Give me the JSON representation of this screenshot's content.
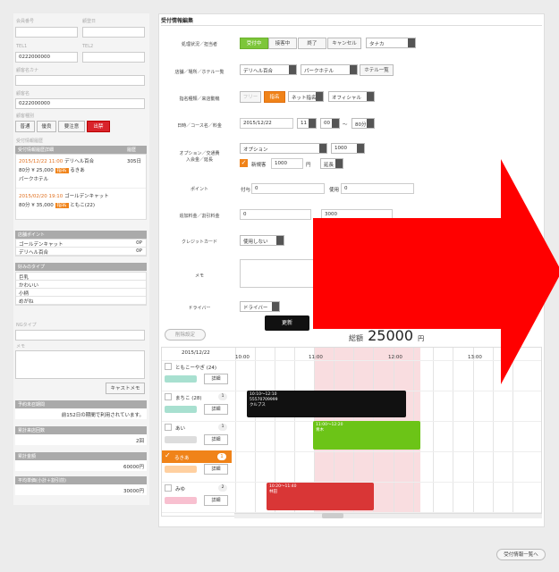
{
  "left": {
    "membership_no_label": "会員番号",
    "joined_label": "顧登日",
    "tel1_label": "TEL1",
    "tel2_label": "TEL2",
    "tel1": "0222000000",
    "name_kana_label": "顧客名カナ",
    "name_label": "顧客名",
    "name_value": "0222000000",
    "type_label": "顧客種別",
    "type_buttons": [
      "普通",
      "優良",
      "要注意",
      "出禁"
    ],
    "history_label": "受付情報履歴",
    "history_header": "受付情報履歴詳細",
    "history_header_right": "履歴",
    "history": [
      {
        "date": "2015/12/22 11:00",
        "shop": "デリヘル百合",
        "tail": "305日",
        "line2": "80分 ¥ 25,000",
        "badge": "指名",
        "girl": "るきあ",
        "line3": "パークホテル"
      },
      {
        "date": "2015/02/20 19:10",
        "shop": "ゴールデンキャット",
        "line2": "80分 ¥ 35,000",
        "badge": "指名",
        "girl": "ともこ(22)"
      }
    ],
    "points_label": "店舗ポイント",
    "points": [
      {
        "shop": "ゴールデンキャット",
        "pt": "0P"
      },
      {
        "shop": "デリヘル百合",
        "pt": "0P"
      }
    ],
    "fav_label": "好みのタイプ",
    "fav": [
      "巨乳",
      "かわいい",
      "小柄",
      "めがね"
    ],
    "ng_label": "NGタイプ",
    "memo_label": "メモ",
    "cast_memo_btn": "キャストメモ",
    "interval_label": "予約未召期間",
    "interval_text": "前152日の期間で利用されています。",
    "total_count_label": "累計来店回数",
    "total_count": "2回",
    "total_amount_label": "累計金額",
    "total_amount": "60000円",
    "avg_label": "平均単価(小計＋割引前)",
    "avg_amount": "30000円"
  },
  "form": {
    "title": "受付情報編集",
    "status_label": "処理状況／担当者",
    "status_buttons": [
      "受付中",
      "接客中",
      "終了",
      "キャンセル"
    ],
    "staff": "タナカ",
    "shop_label": "店舗／場所／ホテル一覧",
    "shop": "デリヘル百合",
    "place": "パークホテル",
    "hotel_list_btn": "ホテル一覧",
    "nom_label": "指名種類／来店動機",
    "nom_buttons": [
      "フリー",
      "指名"
    ],
    "nom_type": "ネット指名",
    "motive": "オフィシャル",
    "date_label": "日時／コース名／料金",
    "date": "2015/12/22",
    "hour": "11",
    "minute": "00",
    "tilde": "〜",
    "course": "80分",
    "option_label1": "オプション／交通費",
    "option_label2": "入会金／延長",
    "option": "オプション",
    "option_fee": "1000",
    "new_label": "新規客",
    "new_fee": "1000",
    "yen": "円",
    "extend": "延長",
    "point_label": "ポイント",
    "point_grant_label": "付与",
    "point_grant": "0",
    "point_use_label": "使用",
    "point_use": "0",
    "discount_label": "追加料金／割引料金",
    "discount1": "0",
    "discount2": "3000",
    "card_label": "クレジットカード",
    "card": "使用しない",
    "memo_label": "メモ",
    "driver_label": "ドライバー",
    "driver": "ドライバー",
    "update_btn": "更新",
    "total_label": "総額",
    "total": "25000",
    "total_unit": "円",
    "delete_btn": "削除設定"
  },
  "schedule": {
    "date": "2015/12/22",
    "times": [
      "10:00",
      "11:00",
      "12:00",
      "13:00"
    ],
    "cast": [
      {
        "name": "ともこーやぎ (24)",
        "count": "",
        "checked": false
      },
      {
        "name": "まちこ (28)",
        "count": "1",
        "checked": false
      },
      {
        "name": "あい",
        "count": "1",
        "checked": false
      },
      {
        "name": "るきあ",
        "count": "1",
        "checked": true
      },
      {
        "name": "みゆ",
        "count": "2",
        "checked": false
      }
    ],
    "detail_label": "詳細",
    "events": [
      {
        "l1": "10:10〜12:10",
        "l2": "55570709999",
        "l3": "クルブス",
        "color": "#111111"
      },
      {
        "l1": "11:00〜12:20",
        "l2": "青木",
        "color": "#6cc417"
      },
      {
        "l1": "10:20〜11:40",
        "l2": "林田",
        "color": "#d93636"
      }
    ]
  },
  "footer_btn": "受付情報一覧へ",
  "colors": {
    "green": "#7dc63a",
    "orange": "#f08319",
    "red": "#ff0000",
    "pinkzone": "#f9dde0"
  }
}
